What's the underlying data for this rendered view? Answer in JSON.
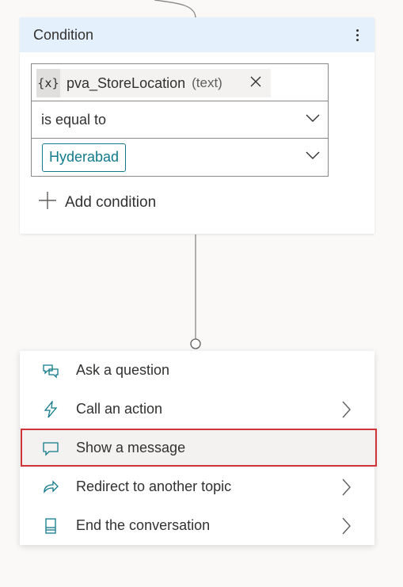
{
  "condition": {
    "title": "Condition",
    "variable": {
      "icon_text": "{x}",
      "name": "pva_StoreLocation",
      "type": "(text)"
    },
    "operator": "is equal to",
    "value": "Hyderabad",
    "add_label": "Add condition"
  },
  "menu": {
    "items": [
      {
        "label": "Ask a question",
        "icon": "chat-question-icon",
        "has_submenu": false
      },
      {
        "label": "Call an action",
        "icon": "lightning-icon",
        "has_submenu": true
      },
      {
        "label": "Show a message",
        "icon": "message-icon",
        "has_submenu": false,
        "selected": true
      },
      {
        "label": "Redirect to another topic",
        "icon": "redirect-arrow-icon",
        "has_submenu": true
      },
      {
        "label": "End the conversation",
        "icon": "end-conversation-icon",
        "has_submenu": true
      }
    ]
  },
  "colors": {
    "accent": "#117a8b",
    "header_bg": "#e4f0fc",
    "highlight": "#d13438"
  }
}
